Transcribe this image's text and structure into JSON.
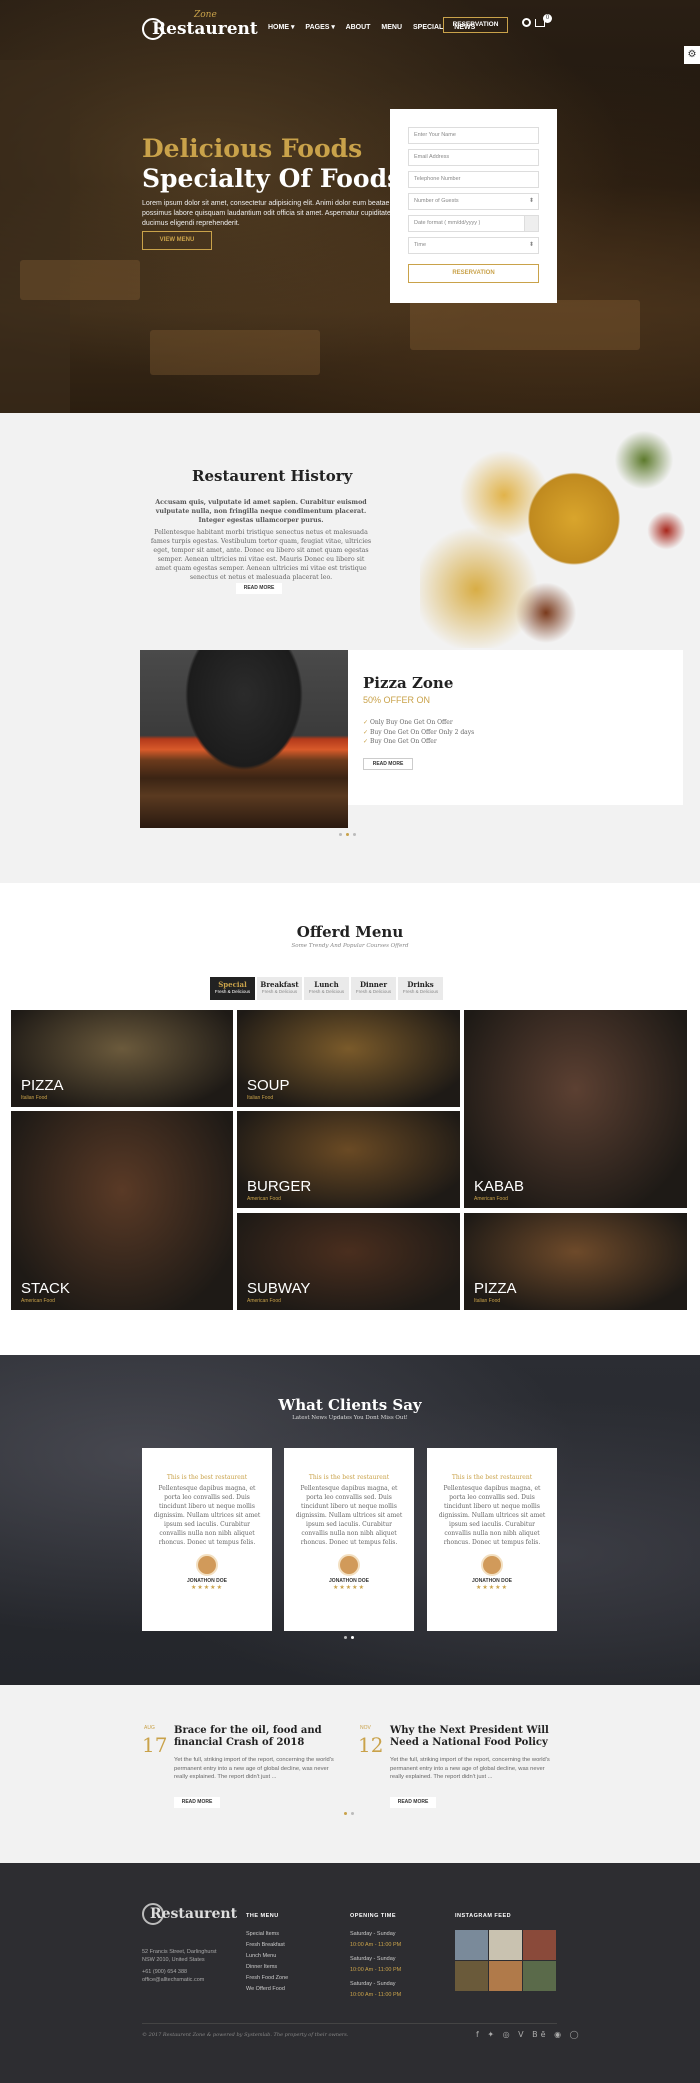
{
  "header": {
    "logo_name": "Restaurent",
    "logo_script": "Zone",
    "menu": [
      "HOME ▾",
      "PAGES ▾",
      "ABOUT",
      "MENU",
      "SPECIAL",
      "NEWS"
    ],
    "reservation_button": "RESERVATION",
    "cart_count": "0"
  },
  "hero": {
    "title_line1": "Delicious Foods",
    "title_line2": "Specialty Of Foods",
    "paragraph": "Lorem ipsum dolor sit amet, consectetur adipisicing elit. Animi dolor eum beatae possimus labore quisquam laudantium odit officia sit amet. Aspernatur cupiditate ducimus eligendi reprehenderit.",
    "view_menu_button": "VIEW MENU"
  },
  "reservation_form": {
    "name_placeholder": "Enter Your Name",
    "email_placeholder": "Email Address",
    "phone_placeholder": "Telephone Number",
    "guests_value": "Number of Guests",
    "date_placeholder": "Date format ( mm/dd/yyyy )",
    "time_value": "Time",
    "submit": "RESERVATION"
  },
  "history": {
    "title": "Restaurent History",
    "quote": "Accusam quis, vulputate id amet sapien. Curabitur euismod vulputate nulla, non fringilla neque condimentum placerat. Integer egestas ullamcorper purus.",
    "paragraph": "Pellentesque habitant morbi tristique senectus netus et malesuada fames turpis egestas. Vestibulum tortor quam, feugiat vitae, ultricies eget, tempor sit amet, ante. Donec eu libero sit amet quam egestas semper. Aenean ultricies mi vitae est. Mauris Donec eu libero sit amet quam egestas semper. Aenean ultricies mi vitae est tristique senectus et netus et malesuada placerat leo.",
    "read_more": "READ MORE"
  },
  "pizza_zone": {
    "title": "Pizza Zone",
    "offer": "50% OFFER ON",
    "items": [
      "Only Buy One Get On Offer",
      "Buy One Get On Offer Only 2 days",
      "Buy One Get On Offer"
    ],
    "read_more": "READ MORE"
  },
  "offered_menu": {
    "title": "Offerd Menu",
    "subtitle": "Some Trendy And Popular Courses Offerd",
    "tabs": [
      {
        "label": "Special",
        "sub": "Fresh & Delicious"
      },
      {
        "label": "Breakfast",
        "sub": "Fresh & Delicious"
      },
      {
        "label": "Lunch",
        "sub": "Fresh & Delicious"
      },
      {
        "label": "Dinner",
        "sub": "Fresh & Delicious"
      },
      {
        "label": "Drinks",
        "sub": "Fresh & Delicious"
      }
    ],
    "items": [
      {
        "name": "PIZZA",
        "cuisine": "Italian Food",
        "color": "#6b5a3c"
      },
      {
        "name": "SOUP",
        "cuisine": "Italian Food",
        "color": "#7a5a2a"
      },
      {
        "name": "STACK",
        "cuisine": "American Food",
        "color": "#5a3a26"
      },
      {
        "name": "BURGER",
        "cuisine": "American Food",
        "color": "#6a4a24"
      },
      {
        "name": "KABAB",
        "cuisine": "American Food",
        "color": "#5c4032"
      },
      {
        "name": "SUBWAY",
        "cuisine": "American Food",
        "color": "#4a2e1e"
      },
      {
        "name": "PIZZA",
        "cuisine": "Italian Food",
        "color": "#6e4a2a"
      }
    ]
  },
  "testimonials": {
    "title": "What Clients Say",
    "subtitle": "Latest News Updates You Dont Miss Out!",
    "cards": [
      {
        "heading": "This is the best restaurent",
        "text": "Pellentesque dapibus magna, et porta leo convallis sed. Duis tincidunt libero ut neque mollis dignissim. Nullam ultrices sit amet ipsum sed iaculis. Curabitur convallis nulla non nibh aliquet rhoncus. Donec ut tempus felis.",
        "name": "JONATHON DOE",
        "stars": "★★★★★"
      },
      {
        "heading": "This is the best restaurent",
        "text": "Pellentesque dapibus magna, et porta leo convallis sed. Duis tincidunt libero ut neque mollis dignissim. Nullam ultrices sit amet ipsum sed iaculis. Curabitur convallis nulla non nibh aliquet rhoncus. Donec ut tempus felis.",
        "name": "JONATHON DOE",
        "stars": "★★★★★"
      },
      {
        "heading": "This is the best restaurent",
        "text": "Pellentesque dapibus magna, et porta leo convallis sed. Duis tincidunt libero ut neque mollis dignissim. Nullam ultrices sit amet ipsum sed iaculis. Curabitur convallis nulla non nibh aliquet rhoncus. Donec ut tempus felis.",
        "name": "JONATHON DOE",
        "stars": "★★★★★"
      }
    ]
  },
  "blog": {
    "posts": [
      {
        "month": "AUG",
        "day": "17",
        "title": "Brace for the oil, food and financial Crash of 2018",
        "text": "Yet the full, striking import of the report, concerning the world's permanent entry into a new age of global decline, was never really explained. The report didn't just ...",
        "read_more": "READ MORE"
      },
      {
        "month": "NOV",
        "day": "12",
        "title": "Why the Next President Will Need a National Food Policy",
        "text": "Yet the full, striking import of the report, concerning the world's permanent entry into a new age of global decline, was never really explained. The report didn't just ...",
        "read_more": "READ MORE"
      }
    ]
  },
  "footer": {
    "logo_name": "Restaurent",
    "address": [
      "52 Francis Street, Darlinghurst",
      "NSW 2010, United States"
    ],
    "phone": "+61 (900) 654 388",
    "email": "office@alltechsmatic.com",
    "menu_heading": "THE MENU",
    "menu_items": [
      "Special Items",
      "Fresh Breakfast",
      "Lunch Menu",
      "Dinner Items",
      "Fresh Food Zone",
      "We Offerd Food"
    ],
    "hours_heading": "OPENING TIME",
    "hours": [
      {
        "days": "Saturday - Sunday",
        "time": "10:00 Am - 11:00 PM"
      },
      {
        "days": "Saturday - Sunday",
        "time": "10:00 Am - 11:00 PM"
      },
      {
        "days": "Saturday - Sunday",
        "time": "10:00 Am - 11:00 PM"
      }
    ],
    "instagram_heading": "INSTAGRAM FEED",
    "copyright": "© 2017 Restaurent Zone & powered by Systemlab. The property of their owners.",
    "social": "f ✦ ◎ V Bē ◉ ◯"
  }
}
